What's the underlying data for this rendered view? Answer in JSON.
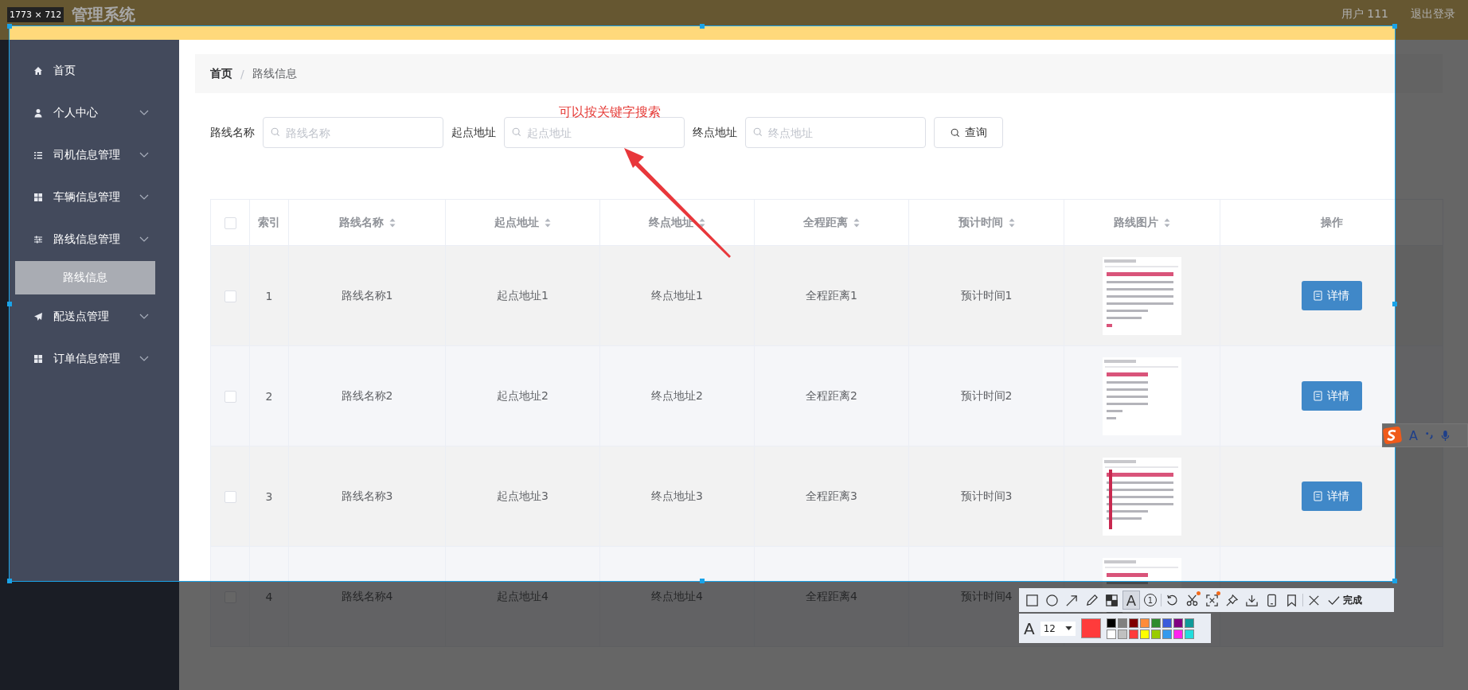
{
  "capture": {
    "size_label": "1773 × 712"
  },
  "header": {
    "title": "管理系统",
    "user": "用户 111",
    "logout": "退出登录"
  },
  "sidebar": {
    "items": [
      {
        "label": "首页",
        "kind": "link"
      },
      {
        "label": "个人中心",
        "kind": "submenu"
      },
      {
        "label": "司机信息管理",
        "kind": "submenu"
      },
      {
        "label": "车辆信息管理",
        "kind": "submenu"
      },
      {
        "label": "路线信息管理",
        "kind": "submenu",
        "children": [
          {
            "label": "路线信息",
            "selected": true
          }
        ]
      },
      {
        "label": "配送点管理",
        "kind": "submenu"
      },
      {
        "label": "订单信息管理",
        "kind": "submenu"
      }
    ]
  },
  "breadcrumb": {
    "items": [
      "首页",
      "路线信息"
    ],
    "separator": "/"
  },
  "search": {
    "fields": [
      {
        "label": "路线名称",
        "placeholder": "路线名称"
      },
      {
        "label": "起点地址",
        "placeholder": "起点地址"
      },
      {
        "label": "终点地址",
        "placeholder": "终点地址"
      }
    ],
    "button": "查询"
  },
  "annotation": {
    "text": "可以按关键字搜索"
  },
  "table": {
    "all_checked": false,
    "columns": [
      {
        "label": "索引",
        "sortable": false
      },
      {
        "label": "路线名称",
        "sortable": true
      },
      {
        "label": "起点地址",
        "sortable": true
      },
      {
        "label": "终点地址",
        "sortable": true
      },
      {
        "label": "全程距离",
        "sortable": true
      },
      {
        "label": "预计时间",
        "sortable": true
      },
      {
        "label": "路线图片",
        "sortable": true
      },
      {
        "label": "操作",
        "sortable": false
      }
    ],
    "rows": [
      {
        "checked": false,
        "cells": [
          "1",
          "路线名称1",
          "起点地址1",
          "终点地址1",
          "全程距离1",
          "预计时间1"
        ],
        "action": "详情"
      },
      {
        "checked": false,
        "cells": [
          "2",
          "路线名称2",
          "起点地址2",
          "终点地址2",
          "全程距离2",
          "预计时间2"
        ],
        "action": "详情"
      },
      {
        "checked": false,
        "cells": [
          "3",
          "路线名称3",
          "起点地址3",
          "终点地址3",
          "全程距离3",
          "预计时间3"
        ],
        "action": "详情"
      },
      {
        "checked": false,
        "cells": [
          "4",
          "路线名称4",
          "起点地址4",
          "终点地址4",
          "全程距离4",
          "预计时间4"
        ]
      }
    ]
  },
  "toolbar": {
    "tools": [
      {
        "kind": "rect",
        "selected": false,
        "badge": false
      },
      {
        "kind": "ellipse",
        "selected": false,
        "badge": false
      },
      {
        "kind": "arrow",
        "selected": false,
        "badge": false
      },
      {
        "kind": "pen",
        "selected": false,
        "badge": false
      },
      {
        "kind": "mosaic",
        "selected": false,
        "badge": false
      },
      {
        "kind": "text",
        "glyph": "A",
        "selected": true,
        "badge": false
      },
      {
        "kind": "number",
        "glyph": "1",
        "selected": false,
        "badge": false
      },
      {
        "kind": "undo",
        "selected": false,
        "badge": false
      },
      {
        "kind": "cut",
        "selected": false,
        "badge": true
      },
      {
        "kind": "scan",
        "selected": false,
        "badge": true
      },
      {
        "kind": "pin",
        "selected": false,
        "badge": false
      },
      {
        "kind": "save",
        "selected": false,
        "badge": false
      },
      {
        "kind": "mobile",
        "selected": false,
        "badge": false
      },
      {
        "kind": "bookmark",
        "selected": false,
        "badge": false
      },
      {
        "kind": "close",
        "selected": false,
        "badge": false
      },
      {
        "kind": "done",
        "label": "完成",
        "selected": false,
        "badge": false
      }
    ]
  },
  "text_options": {
    "glyph": "A",
    "font_size": "12",
    "current": {
      "color": "#ff3b3b"
    },
    "palette": [
      {
        "color": "#000000"
      },
      {
        "color": "#808080"
      },
      {
        "color": "#800000"
      },
      {
        "color": "#ff8c3a"
      },
      {
        "color": "#2e8b2e"
      },
      {
        "color": "#3b5bdb"
      },
      {
        "color": "#800080"
      },
      {
        "color": "#0f9a9a"
      },
      {
        "color": "#ffffff"
      },
      {
        "color": "#c0c0c0"
      },
      {
        "color": "#ff3b3b"
      },
      {
        "color": "#ffff00"
      },
      {
        "color": "#99cc00"
      },
      {
        "color": "#3399ee"
      },
      {
        "color": "#ff22ee"
      },
      {
        "color": "#22dddd"
      }
    ]
  },
  "ime_toolbar": {
    "mode_label": "A"
  }
}
